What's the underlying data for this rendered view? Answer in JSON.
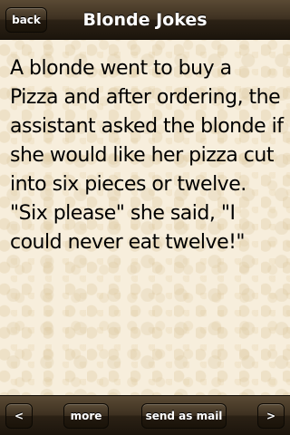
{
  "navbar": {
    "back_label": "back",
    "title": "Blonde Jokes"
  },
  "joke": {
    "text": "A blonde went to buy a Pizza and after ordering, the assistant asked the blonde if she would like her pizza cut into six pieces or twelve. \"Six please\" she said, \"I could never eat twelve!\""
  },
  "toolbar": {
    "prev_label": "<",
    "more_label": "more",
    "mail_label": "send as mail",
    "next_label": ">"
  },
  "colors": {
    "bar": "#3e3121",
    "background": "#f7eedc"
  }
}
